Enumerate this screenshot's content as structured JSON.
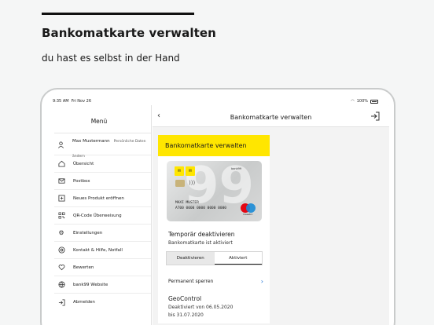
{
  "headline": "Bankomatkarte verwalten",
  "subline": "du hast es selbst in der Hand",
  "status_bar": {
    "time": "9:35 AM",
    "date": "Fri Nov 26",
    "battery": "100%"
  },
  "sidebar": {
    "title": "Menü",
    "user": {
      "name": "Max Mustermann",
      "subtitle": "Persönliche Daten ändern"
    },
    "items": [
      {
        "label": "Übersicht",
        "icon": "home-icon"
      },
      {
        "label": "Postbox",
        "icon": "mail-icon"
      },
      {
        "label": "Neues Produkt eröffnen",
        "icon": "plus-square-icon"
      },
      {
        "label": "QR-Code Überweisung",
        "icon": "qr-code-icon"
      },
      {
        "label": "Einstellungen",
        "icon": "gear-icon"
      },
      {
        "label": "Kontakt & Hilfe, Notfall",
        "icon": "support-icon"
      },
      {
        "label": "Bewerten",
        "icon": "heart-icon"
      },
      {
        "label": "bank99 Website",
        "icon": "globe-icon"
      },
      {
        "label": "Abmelden",
        "icon": "logout-icon"
      }
    ]
  },
  "nav": {
    "title": "Bankomatkarte verwalten"
  },
  "card": {
    "header": "Bankomatkarte verwalten",
    "bankcard": {
      "cardholder": "MAXI MUSTER",
      "number": "AT00 0000 0000 0000 0000",
      "network": "maestro",
      "bank_label": "bank99",
      "big_numeral": "99"
    },
    "temporary": {
      "title": "Temporär deaktivieren",
      "status": "Bankomatkarte ist aktiviert"
    },
    "segment": {
      "off_label": "Deaktivieren",
      "on_label": "Aktiviert",
      "selected": "Aktiviert"
    },
    "permanent": {
      "label": "Permanent sperren"
    },
    "geocontrol": {
      "title": "GeoControl",
      "line1": "Deaktiviert von 06.05.2020",
      "line2": "bis 31.07.2020"
    }
  },
  "colors": {
    "accent_yellow": "#ffe600",
    "link_blue": "#1a6fd6",
    "mc_red": "#e30613",
    "mc_blue": "#1a8bd6"
  }
}
